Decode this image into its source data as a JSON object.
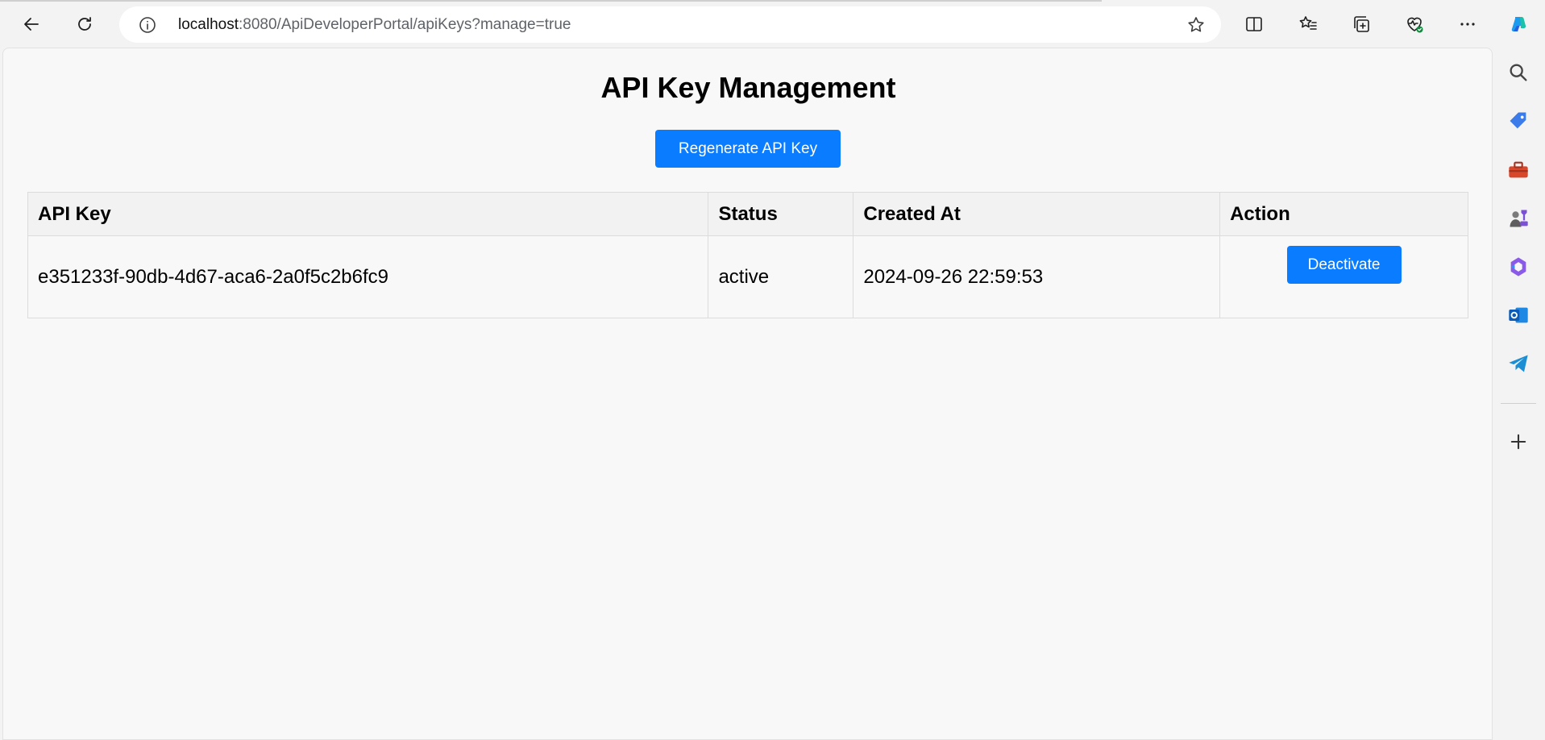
{
  "browser": {
    "url_host": "localhost",
    "url_rest": ":8080/ApiDeveloperPortal/apiKeys?manage=true"
  },
  "page": {
    "title": "API Key Management",
    "regenerate_label": "Regenerate API Key"
  },
  "table": {
    "headers": [
      "API Key",
      "Status",
      "Created At",
      "Action"
    ],
    "rows": [
      {
        "api_key": "e351233f-90db-4d67-aca6-2a0f5c2b6fc9",
        "status": "active",
        "created_at": "2024-09-26 22:59:53",
        "action_label": "Deactivate"
      }
    ]
  },
  "colors": {
    "accent": "#0a7cff",
    "page_bg": "#f8f8f8",
    "header_bg": "#f2f2f2"
  },
  "sidebar_icons": [
    "search-icon",
    "shopping-tag-icon",
    "toolbox-icon",
    "games-icon",
    "copilot-m365-icon",
    "outlook-icon",
    "telegram-icon",
    "add-icon"
  ]
}
